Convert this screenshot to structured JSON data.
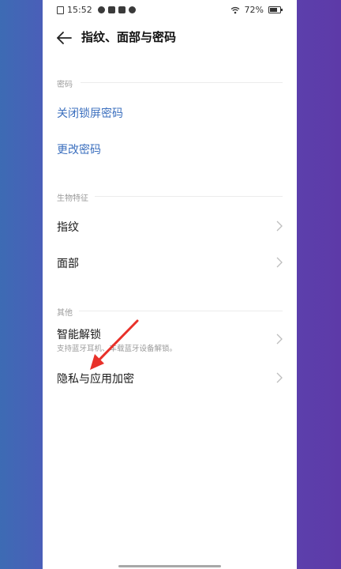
{
  "status_bar": {
    "time": "15:52",
    "battery": "72%",
    "icons": [
      "sim-icon",
      "app-icon-1",
      "app-icon-2",
      "app-icon-3",
      "app-icon-4",
      "wifi-icon",
      "battery-icon"
    ]
  },
  "header": {
    "title": "指纹、面部与密码",
    "back_icon": "back-arrow-icon"
  },
  "sections": {
    "password": {
      "label": "密码",
      "items": [
        {
          "label": "关闭锁屏密码"
        },
        {
          "label": "更改密码"
        }
      ]
    },
    "biometrics": {
      "label": "生物特征",
      "items": [
        {
          "label": "指纹"
        },
        {
          "label": "面部"
        }
      ]
    },
    "other": {
      "label": "其他",
      "items": [
        {
          "label": "智能解锁",
          "sub": "支持蓝牙耳机、车载蓝牙设备解锁。"
        },
        {
          "label": "隐私与应用加密"
        }
      ]
    }
  },
  "colors": {
    "accent_blue": "#3b6fbe",
    "annotation_red": "#e8312a",
    "background_gradient_left": "#3d6bb4",
    "background_gradient_right": "#5d3aa8"
  }
}
